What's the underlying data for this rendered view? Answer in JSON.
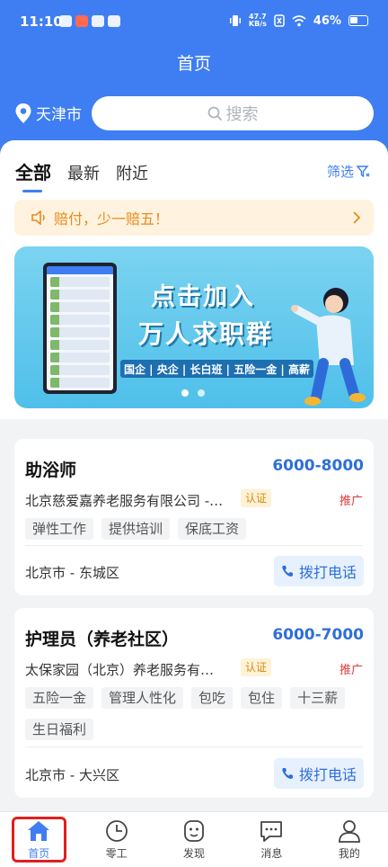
{
  "status": {
    "time": "11:10",
    "speed_value": "47.7",
    "speed_unit": "KB/s",
    "battery": "46%"
  },
  "header": {
    "title": "首页",
    "city": "天津市",
    "search_placeholder": "搜索"
  },
  "tabs": [
    {
      "label": "全部",
      "active": true
    },
    {
      "label": "最新",
      "active": false
    },
    {
      "label": "附近",
      "active": false
    }
  ],
  "filter_label": "筛选",
  "notice": {
    "text": "赔付，少一赔五！"
  },
  "banner": {
    "line1": "点击加入",
    "line2": "万人求职群",
    "tags": "国企 | 央企 | 长白班 | 五险一金 | 高薪"
  },
  "jobs": [
    {
      "title": "助浴师",
      "salary": "6000-8000",
      "company": "北京慈爱嘉养老服务有限公司 -…",
      "verified": "认证",
      "promo": "推广",
      "tags": [
        "弹性工作",
        "提供培训",
        "保底工资"
      ],
      "location": "北京市 - 东城区",
      "call": "拨打电话"
    },
    {
      "title": "护理员（养老社区）",
      "salary": "6000-7000",
      "company": "太保家园（北京）养老服务有…",
      "verified": "认证",
      "promo": "推广",
      "tags": [
        "五险一金",
        "管理人性化",
        "包吃",
        "包住",
        "十三薪",
        "生日福利"
      ],
      "location": "北京市 - 大兴区",
      "call": "拨打电话"
    }
  ],
  "tabbar": [
    {
      "label": "首页",
      "icon": "home-icon",
      "active": true
    },
    {
      "label": "零工",
      "icon": "clock-icon",
      "active": false
    },
    {
      "label": "发现",
      "icon": "discover-icon",
      "active": false
    },
    {
      "label": "消息",
      "icon": "message-icon",
      "active": false
    },
    {
      "label": "我的",
      "icon": "profile-icon",
      "active": false
    }
  ],
  "colors": {
    "primary": "#3f7ef2",
    "salary": "#2e6fd8",
    "promo": "#e03a3a",
    "notice": "#e88b1e"
  }
}
